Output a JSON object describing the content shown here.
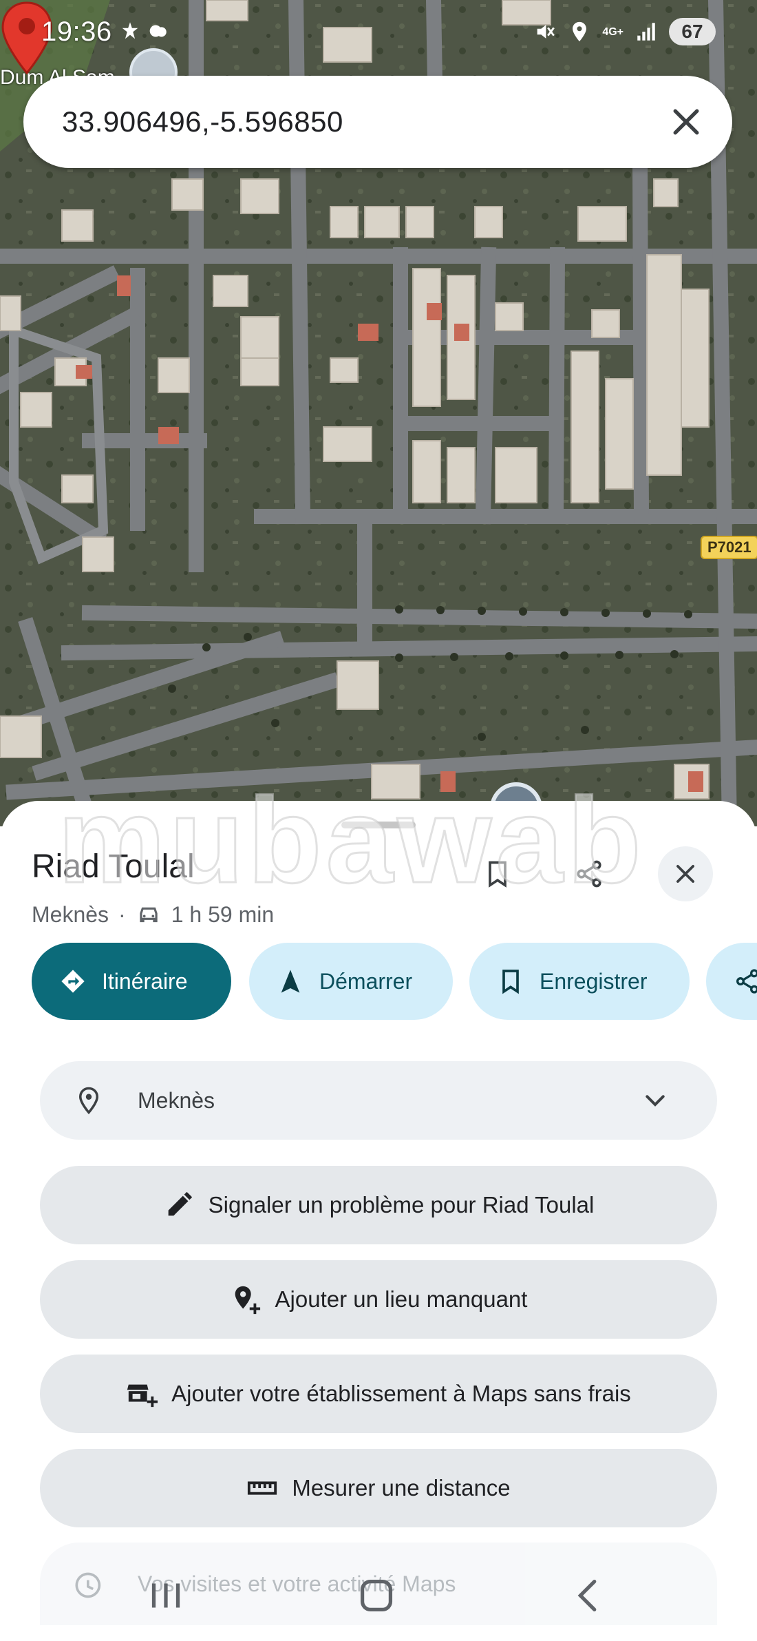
{
  "status_bar": {
    "time": "19:36",
    "network": "4G+",
    "battery": "67"
  },
  "search": {
    "query": "33.906496,-5.596850"
  },
  "map": {
    "place_label": "Dum Al Sam",
    "road_shield": "P7021",
    "pin_color": "#d93025"
  },
  "place": {
    "title": "Riad Toulal",
    "city": "Meknès",
    "separator": "·",
    "travel_time": "1 h 59 min"
  },
  "actions": [
    {
      "label": "Itinéraire",
      "icon": "directions-icon"
    },
    {
      "label": "Démarrer",
      "icon": "navigation-arrow-icon"
    },
    {
      "label": "Enregistrer",
      "icon": "bookmark-icon"
    },
    {
      "label": "",
      "icon": "share-icon"
    }
  ],
  "location_row": {
    "label": "Meknès"
  },
  "buttons": {
    "report": "Signaler un problème pour Riad Toulal",
    "add_place": "Ajouter un lieu manquant",
    "add_business": "Ajouter votre établissement à Maps sans frais",
    "measure": "Mesurer une distance"
  },
  "history_row": {
    "label": "Vos visites et votre activité Maps"
  },
  "watermark": "mubawab",
  "colors": {
    "primary": "#0c6b7a",
    "chip_bg": "#d3eefa",
    "pill_bg": "#e5e8eb"
  }
}
